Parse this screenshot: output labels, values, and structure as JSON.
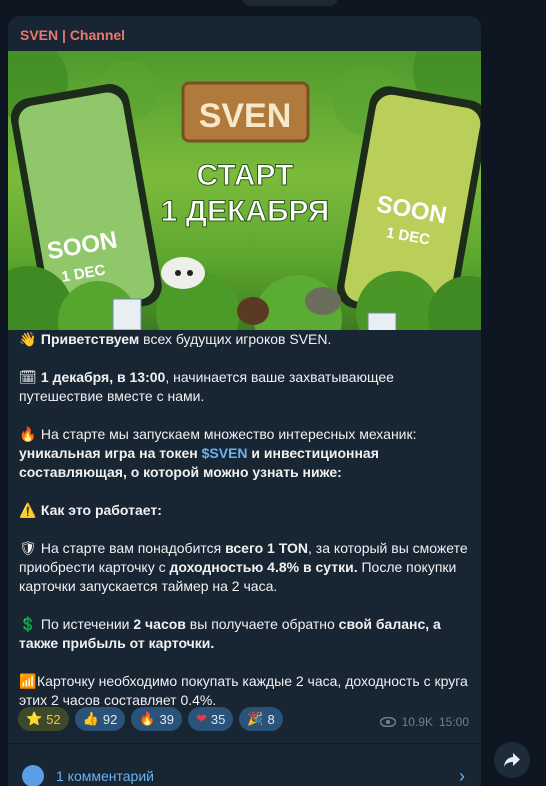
{
  "channel": {
    "name": "SVEN | Channel"
  },
  "banner": {
    "logo": "SVEN",
    "headline_1": "СТАРТ",
    "headline_2": "1 ДЕКАБРЯ",
    "phone_left": {
      "soon": "SOON",
      "date": "1 DEC"
    },
    "phone_right": {
      "soon": "SOON",
      "date": "1 DEC"
    }
  },
  "post": {
    "line1": {
      "emoji": "👋",
      "bold": "Приветствуем",
      "text": " всех будущих игроков SVEN."
    },
    "line2": {
      "emoji": "🗓",
      "bold": "1 декабря, в 13:00",
      "text": ", начинается ваше захватывающее путешествие вместе с нами."
    },
    "line3": {
      "emoji": "🔥",
      "text": "На старте мы запускаем множество интересных механик: ",
      "bold1": "уникальная игра на токен ",
      "accent": "$SVEN",
      "bold2": " и инвестиционная составляющая, о которой можно узнать ниже:"
    },
    "line4": {
      "emoji": "⚠️",
      "bold": "Как это работает:"
    },
    "line5": {
      "emoji": "🛡",
      "text1": "На старте вам понадобится ",
      "bold1": "всего 1 TON",
      "text2": ", за который вы сможете приобрести карточку с ",
      "bold2": "доходностью 4.8% в сутки.",
      "text3": " После покупки карточки запускается таймер на 2 часа."
    },
    "line6": {
      "emoji": "💲",
      "text1": "По истечении ",
      "bold1": "2 часов",
      "text2": " вы получаете обратно ",
      "bold2": "свой баланс, а также прибыль от карточки."
    },
    "line7": {
      "emoji": "📶",
      "text": "Карточку необходимо покупать каждые 2 часа, доходность с круга этих 2 часов составляет 0.4%."
    }
  },
  "reactions": [
    {
      "icon": "star-icon",
      "glyph": "⭐",
      "count": "52"
    },
    {
      "icon": "thumbs-up-icon",
      "glyph": "👍",
      "count": "92"
    },
    {
      "icon": "fire-icon",
      "glyph": "🔥",
      "count": "39"
    },
    {
      "icon": "heart-icon",
      "glyph": "❤",
      "count": "35"
    },
    {
      "icon": "party-popper-icon",
      "glyph": "🎉",
      "count": "8"
    }
  ],
  "meta": {
    "views": "10.9K",
    "time": "15:00"
  },
  "comments": {
    "label": "1 комментарий"
  },
  "colors": {
    "channel_name": "#e9786c",
    "accent": "#6ab3f3",
    "bubble": "#182533",
    "background": "#0e1621"
  }
}
